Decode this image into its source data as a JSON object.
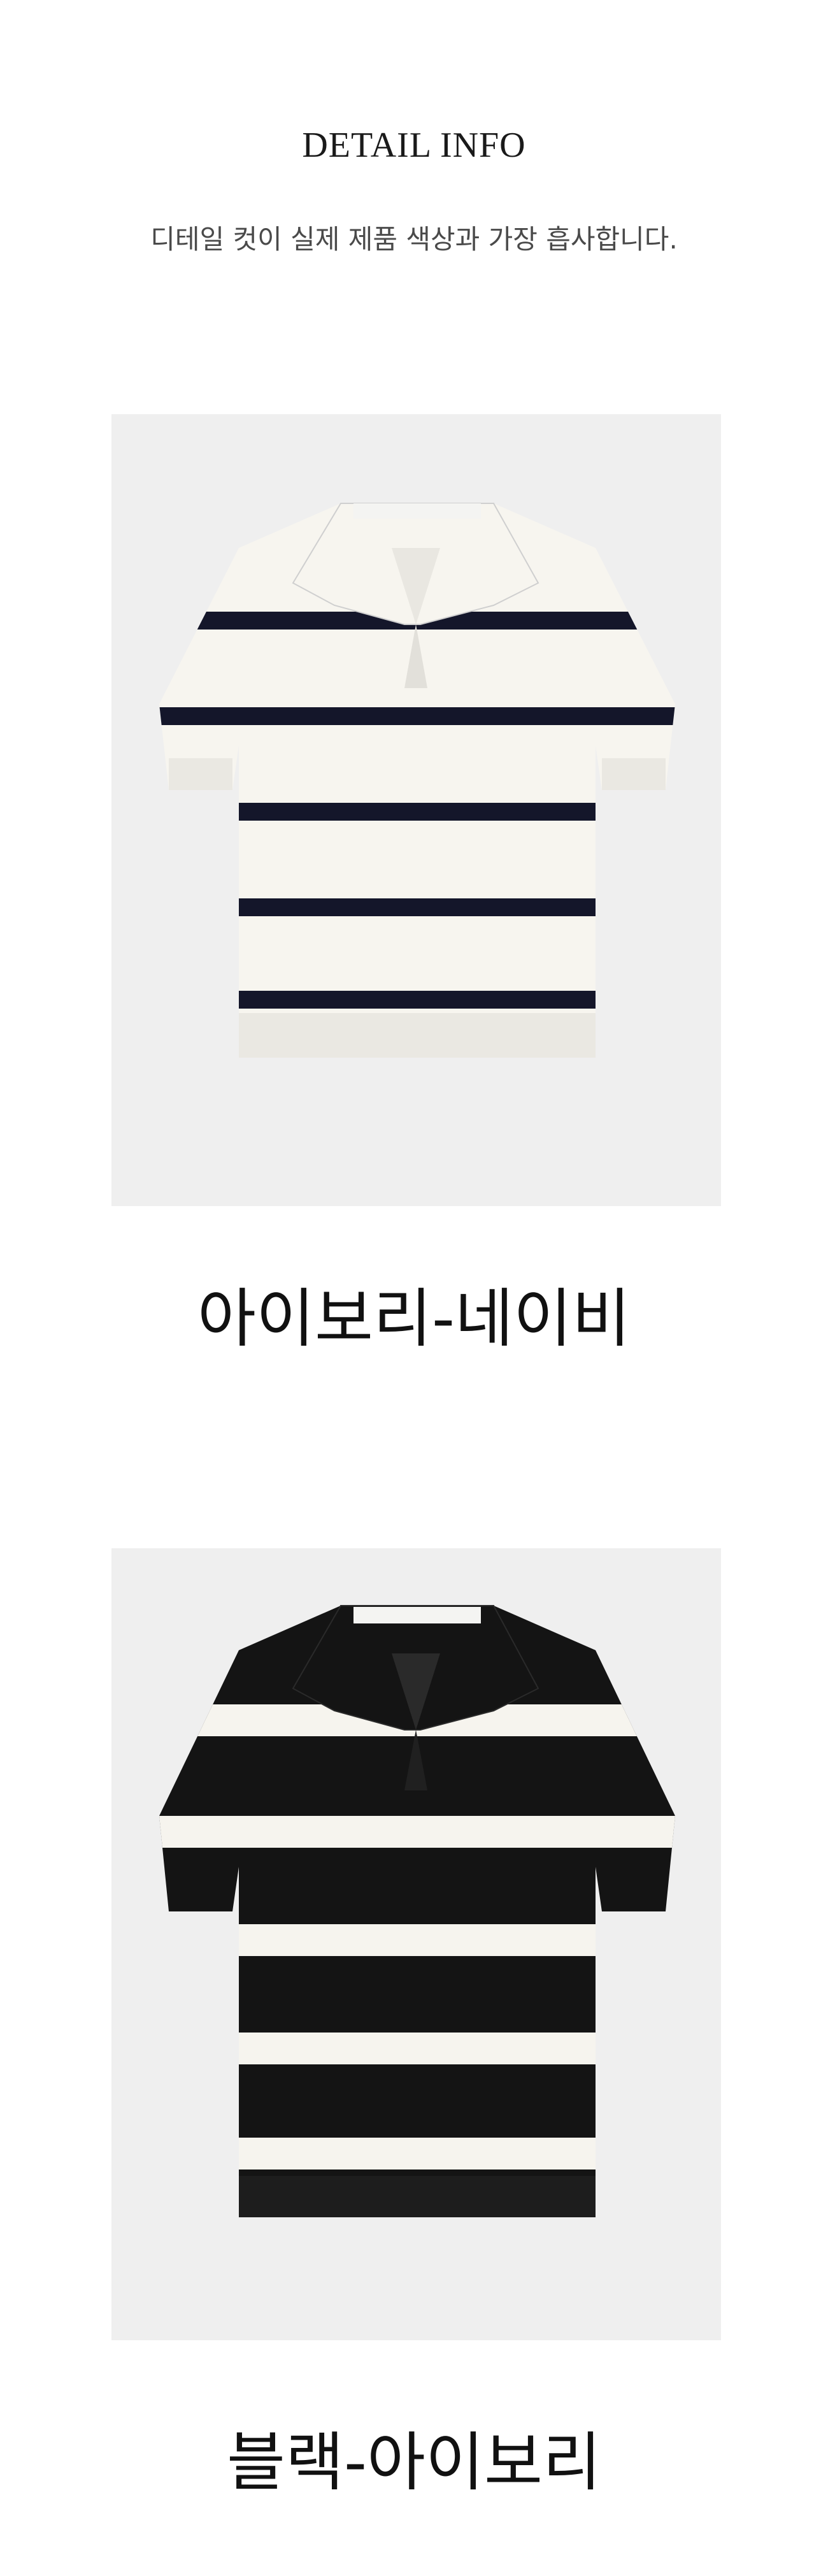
{
  "header": {
    "title": "DETAIL INFO",
    "note": "디테일 컷이 실제 제품 색상과 가장 흡사합니다."
  },
  "products": [
    {
      "caption": "아이보리-네이비",
      "body_color": "#f7f5ef",
      "stripe_color": "#14162a",
      "collar_color": "#f7f5ef",
      "label_color": "#f4f4f2"
    },
    {
      "caption": "블랙-아이보리",
      "body_color": "#141414",
      "stripe_color": "#f6f4ee",
      "collar_color": "#141414",
      "label_color": "#f4f4f2"
    }
  ],
  "colors": {
    "photo_background": "#efefef",
    "title_text": "#1a1a1a",
    "note_text": "#4a4a4a"
  }
}
